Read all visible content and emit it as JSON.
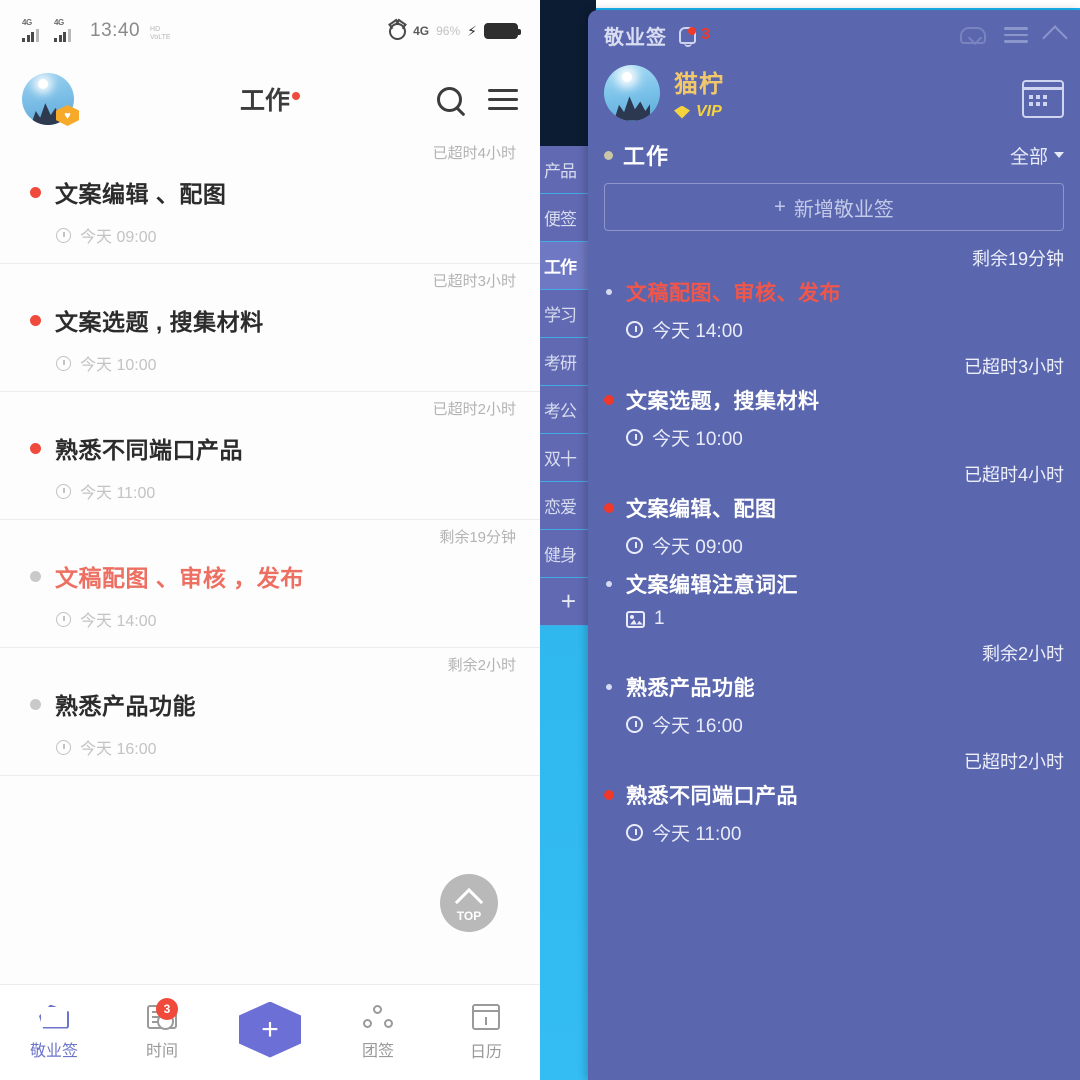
{
  "phone": {
    "statusbar": {
      "signal1": "4G",
      "signal2": "4G",
      "time": "13:40",
      "hd_line1": "HD",
      "hd_line2": "VoLTE",
      "alarm_icon": "alarm-icon",
      "network": "4G",
      "battery_pct": "96%",
      "charge_icon": "bolt-icon",
      "battery_icon": "battery-icon"
    },
    "appbar": {
      "avatar_name": "user-avatar",
      "vip_badge": "♥",
      "title": "工作",
      "search_icon": "search-icon",
      "menu_icon": "menu-icon"
    },
    "items": [
      {
        "meta": "已超时4小时",
        "title": "文案编辑 、配图",
        "time": "今天 09:00",
        "urgent": false,
        "dim": false
      },
      {
        "meta": "已超时3小时",
        "title": "文案选题 , 搜集材料",
        "time": "今天 10:00",
        "urgent": false,
        "dim": false
      },
      {
        "meta": "已超时2小时",
        "title": "熟悉不同端口产品",
        "time": "今天 11:00",
        "urgent": false,
        "dim": false
      },
      {
        "meta": "剩余19分钟",
        "title": "文稿配图 、审核 ，发布",
        "time": "今天 14:00",
        "urgent": true,
        "dim": true
      },
      {
        "meta": "剩余2小时",
        "title": "熟悉产品功能",
        "time": "今天 16:00",
        "urgent": false,
        "dim": true
      }
    ],
    "top_button": {
      "label": "TOP",
      "icon": "chevron-up-icon"
    },
    "tabbar": [
      {
        "label": "敬业签",
        "icon": "note-icon",
        "active": true,
        "badge": ""
      },
      {
        "label": "时间",
        "icon": "time-icon",
        "active": false,
        "badge": "3"
      },
      {
        "label": "",
        "icon": "add-icon",
        "active": false,
        "badge": ""
      },
      {
        "label": "团签",
        "icon": "team-icon",
        "active": false,
        "badge": ""
      },
      {
        "label": "日历",
        "icon": "calendar-icon",
        "active": false,
        "badge": ""
      }
    ]
  },
  "desktop": {
    "side_tabs": [
      {
        "label": "产品",
        "active": false
      },
      {
        "label": "便签",
        "active": false
      },
      {
        "label": "工作",
        "active": true
      },
      {
        "label": "学习",
        "active": false
      },
      {
        "label": "考研",
        "active": false
      },
      {
        "label": "考公",
        "active": false
      },
      {
        "label": "双十",
        "active": false
      },
      {
        "label": "恋爱",
        "active": false
      },
      {
        "label": "健身",
        "active": false
      },
      {
        "label": "+",
        "active": false
      }
    ],
    "titlebar": {
      "logo": "敬业签",
      "bell_icon": "bell-icon",
      "bell_count": "3",
      "cloud_icon": "cloud-sync-icon",
      "burger_icon": "menu-icon",
      "collapse_icon": "chevron-up-icon"
    },
    "user": {
      "avatar_name": "user-avatar",
      "name": "猫柠",
      "vip_label": "VIP",
      "diamond_icon": "diamond-icon",
      "calendar_icon": "calendar-icon"
    },
    "section": {
      "title": "工作",
      "filter": "全部",
      "filter_icon": "chevron-down-icon",
      "add_label": "新增敬业签",
      "add_icon": "plus-icon"
    },
    "items": [
      {
        "meta": "剩余19分钟",
        "title": "文稿配图、审核、发布",
        "time": "今天 14:00",
        "urgent": true,
        "dim": true,
        "img_count": ""
      },
      {
        "meta": "已超时3小时",
        "title": "文案选题，搜集材料",
        "time": "今天 10:00",
        "urgent": false,
        "dim": false,
        "img_count": ""
      },
      {
        "meta": "已超时4小时",
        "title": "文案编辑、配图",
        "time": "今天 09:00",
        "urgent": false,
        "dim": false,
        "img_count": ""
      },
      {
        "meta": "",
        "title": "文案编辑注意词汇",
        "time": "",
        "urgent": false,
        "dim": true,
        "img_count": "1"
      },
      {
        "meta": "剩余2小时",
        "title": "熟悉产品功能",
        "time": "今天 16:00",
        "urgent": false,
        "dim": true,
        "img_count": ""
      },
      {
        "meta": "已超时2小时",
        "title": "熟悉不同端口产品",
        "time": "今天 11:00",
        "urgent": false,
        "dim": false,
        "img_count": ""
      }
    ]
  },
  "colors": {
    "panel_bg": "#5a66ae",
    "accent_red": "#f0392b",
    "urgent_text": "#f0564a",
    "vip_gold": "#f5d33f",
    "phone_accent": "#6b74c9",
    "desktop_wallpaper": "#2fb8ee"
  }
}
